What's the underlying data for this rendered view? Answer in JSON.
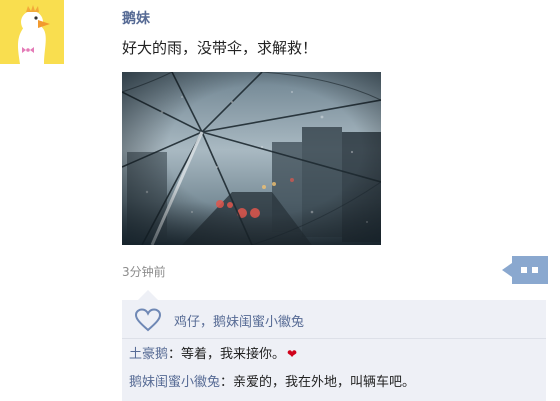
{
  "post": {
    "username": "鹅妹",
    "text": "好大的雨，没带伞，求解救！",
    "time": "3分钟前"
  },
  "likes": {
    "names": "鸡仔，鹅妹闺蜜小徽兔"
  },
  "comments": [
    {
      "author": "土豪鹅",
      "separator": "：",
      "text": "等着，我来接你。",
      "emoji": "❤"
    },
    {
      "author": "鹅妹闺蜜小徽兔",
      "separator": "：",
      "text": "亲爱的，我在外地，叫辆车吧。"
    }
  ],
  "icons": {
    "avatar": "duck-avatar-icon",
    "comment_button": "comment-dots-icon",
    "like": "heart-outline-icon",
    "emoji": "red-heart-icon"
  },
  "colors": {
    "link": "#576b95",
    "panel_bg": "#eef0f6",
    "comment_button_bg": "#8aa8cf",
    "heart": "#d0021b"
  }
}
